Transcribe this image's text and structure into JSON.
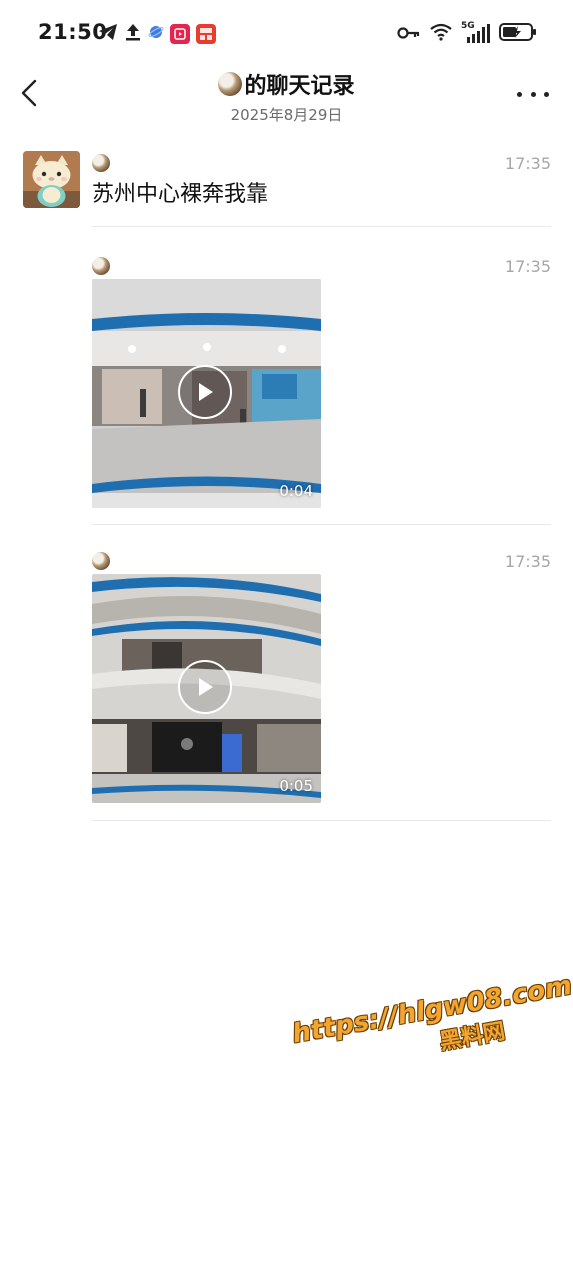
{
  "status_bar": {
    "time": "21:50",
    "icons_left": [
      "telegram-icon",
      "upload-icon",
      "planet-icon",
      "video-app-icon",
      "news-app-icon"
    ],
    "icons_right": [
      "vpn-key-icon",
      "wifi-icon",
      "signal-5g-icon",
      "battery-charging-icon"
    ],
    "network": "5G"
  },
  "header": {
    "title": "的聊天记录",
    "subtitle": "2025年8月29日"
  },
  "records": [
    {
      "type": "text",
      "time": "17:35",
      "text": "苏州中心裸奔我靠"
    },
    {
      "type": "video",
      "time": "17:35",
      "duration": "0:04"
    },
    {
      "type": "video",
      "time": "17:35",
      "duration": "0:05"
    }
  ],
  "watermark": {
    "url": "https://hlgw08.com",
    "label": "黑料网"
  },
  "colors": {
    "accent_watermark": "#f3a531",
    "time_gray": "#a6a6a6",
    "divider": "#e8e8e8"
  }
}
